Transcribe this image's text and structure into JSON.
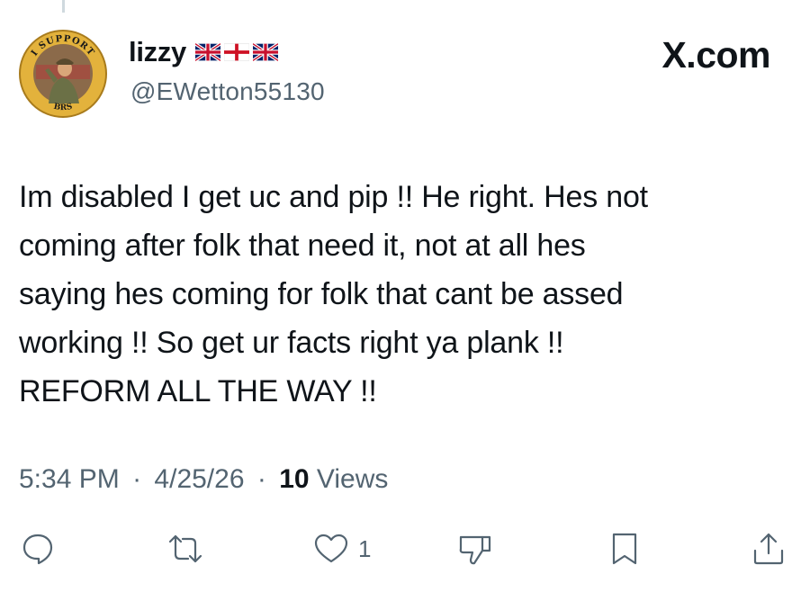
{
  "avatar": {
    "badge_top": "I SUPPORT",
    "badge_bottom": "BRS",
    "ring_color": "#e3b23c"
  },
  "user": {
    "name": "lizzy",
    "handle": "@EWetton55130",
    "flags": [
      "uk-flag-icon",
      "england-flag-icon",
      "uk-flag-icon"
    ]
  },
  "brand": "X.com",
  "tweet": {
    "lines": [
      "Im disabled I get uc and pip !! He right. Hes not",
      "coming after folk that need it, not at all hes",
      "saying hes coming for folk that cant be assed",
      "working !! So get ur facts right ya plank !!",
      "REFORM ALL THE WAY !!"
    ]
  },
  "meta": {
    "time": "5:34 PM",
    "date": "4/25/26",
    "views_count": "10",
    "views_label": "Views",
    "separator": "·"
  },
  "actions": {
    "reply_icon": "reply-icon",
    "retweet_icon": "retweet-icon",
    "like_icon": "heart-icon",
    "like_count": "1",
    "dislike_icon": "thumbs-down-icon",
    "bookmark_icon": "bookmark-icon",
    "share_icon": "share-icon"
  },
  "colors": {
    "text": "#0f1419",
    "secondary": "#536471",
    "england_red": "#ce1124",
    "union_blue": "#012169"
  }
}
